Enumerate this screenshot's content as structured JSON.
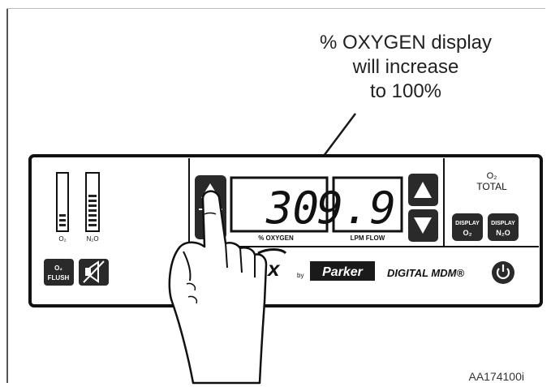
{
  "callout": {
    "line1": "% OXYGEN display",
    "line2": "will increase",
    "line3": "to 100%"
  },
  "panel": {
    "flowtube_o2_label": "O₂",
    "flowtube_n2o_label": "N₂O",
    "o2_flush_label_top": "O₂",
    "o2_flush_label_bottom": "FLUSH",
    "oxygen_value": "30",
    "oxygen_label": "% OXYGEN",
    "flow_value": "9.9",
    "flow_label": "LPM FLOW",
    "mode_label_top": "O₂",
    "mode_label_bottom": "TOTAL",
    "display_o2_top": "DISPLAY",
    "display_o2_bottom": "O₂",
    "display_n2o_top": "DISPLAY",
    "display_n2o_bottom": "N₂O",
    "brand_by": "by",
    "brand_parker": "Parker",
    "brand_model": "DIGITAL MDM®"
  },
  "figure_id": "AA174100i",
  "colors": {
    "ink": "#1a1a1a",
    "panel_fill": "#ffffff",
    "button_fill": "#2a2a2a"
  },
  "icons": {
    "arrow_up": "triangle-up-icon",
    "arrow_down": "triangle-down-icon",
    "alarm_silence": "speaker-mute-icon",
    "power": "power-icon",
    "hand": "pointing-hand-icon"
  }
}
